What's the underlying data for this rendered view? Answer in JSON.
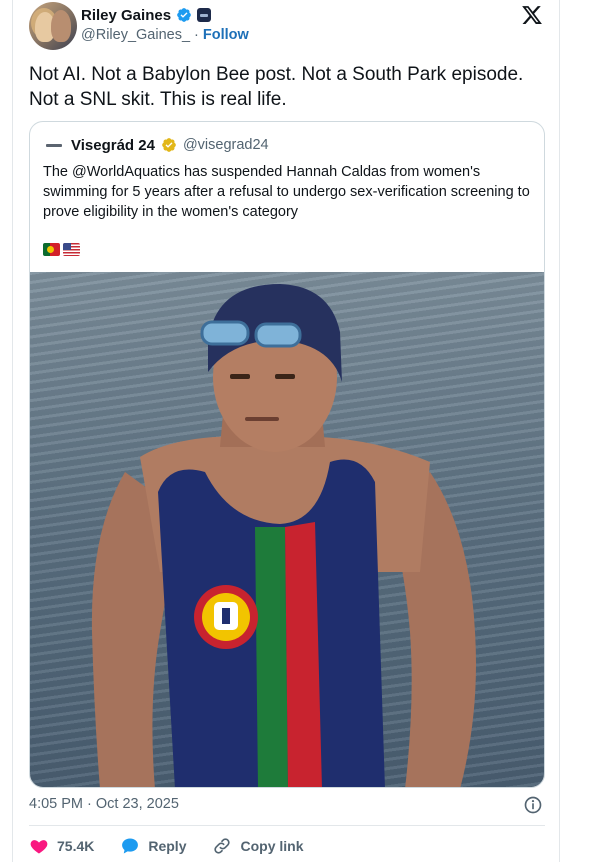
{
  "author": {
    "name": "Riley Gaines",
    "handle": "@Riley_Gaines_",
    "separator": "·",
    "follow_label": "Follow",
    "verified_color": "#1d9bf0",
    "affiliate_icon": "affiliate-badge-icon"
  },
  "platform_icon": "x-logo-icon",
  "tweet": {
    "text": "Not AI. Not a Babylon Bee post. Not a South Park episode. Not a SNL skit. This is real life."
  },
  "quoted": {
    "name": "Visegrád 24",
    "handle": "@visegrad24",
    "badge_color": "#e2b719",
    "text": "The @WorldAquatics has suspended Hannah Caldas from women's swimming for 5 years after a refusal to undergo sex-verification screening to prove eligibility in the women's category",
    "flags": [
      "portugal-flag-icon",
      "usa-flag-icon"
    ],
    "image": "swimmer-photo"
  },
  "meta": {
    "timestamp": "4:05 PM · Oct 23, 2025",
    "info_icon": "info-icon"
  },
  "actions": {
    "likes_count": "75.4K",
    "reply_label": "Reply",
    "copy_link_label": "Copy link",
    "like_color": "#f91880",
    "reply_color": "#1d9bf0"
  }
}
